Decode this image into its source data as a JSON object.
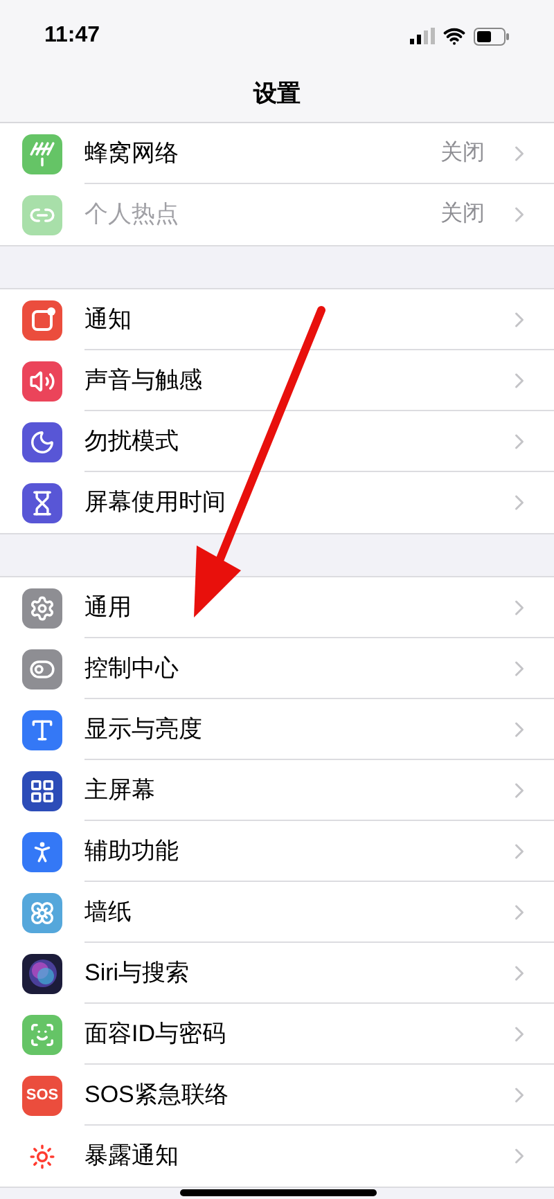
{
  "status_bar": {
    "time": "11:47"
  },
  "header": {
    "title": "设置"
  },
  "groups": [
    {
      "items": [
        {
          "label": "蜂窝网络",
          "value": "关闭",
          "kind": "antenna",
          "color": "#65c466",
          "disabled": false
        },
        {
          "label": "个人热点",
          "value": "关闭",
          "kind": "link",
          "color": "#a8dfa9",
          "disabled": true
        }
      ]
    },
    {
      "items": [
        {
          "label": "通知",
          "kind": "notification",
          "color": "#eb4d3d",
          "disabled": false
        },
        {
          "label": "声音与触感",
          "kind": "sound",
          "color": "#eb445a",
          "disabled": false
        },
        {
          "label": "勿扰模式",
          "kind": "moon",
          "color": "#5856d6",
          "disabled": false
        },
        {
          "label": "屏幕使用时间",
          "kind": "hourglass",
          "color": "#5856d6",
          "disabled": false
        }
      ]
    },
    {
      "items": [
        {
          "label": "通用",
          "kind": "gear",
          "color": "#8e8e93",
          "disabled": false
        },
        {
          "label": "控制中心",
          "kind": "toggles",
          "color": "#8e8e93",
          "disabled": false
        },
        {
          "label": "显示与亮度",
          "kind": "type",
          "color": "#3478f6",
          "disabled": false
        },
        {
          "label": "主屏幕",
          "kind": "grid",
          "color": "#2c4cb8",
          "disabled": false
        },
        {
          "label": "辅助功能",
          "kind": "accessibility",
          "color": "#3478f6",
          "disabled": false
        },
        {
          "label": "墙纸",
          "kind": "flower",
          "color": "#55a7db",
          "disabled": false
        },
        {
          "label": "Siri与搜索",
          "kind": "siri",
          "color": "#1c1c3a",
          "disabled": false
        },
        {
          "label": "面容ID与密码",
          "kind": "face",
          "color": "#65c466",
          "disabled": false
        },
        {
          "label": "SOS紧急联络",
          "kind": "text",
          "icon_text": "SOS",
          "color": "#eb4d3d",
          "disabled": false
        },
        {
          "label": "暴露通知",
          "kind": "sun",
          "color": "#ffffff",
          "disabled": false
        }
      ]
    }
  ]
}
